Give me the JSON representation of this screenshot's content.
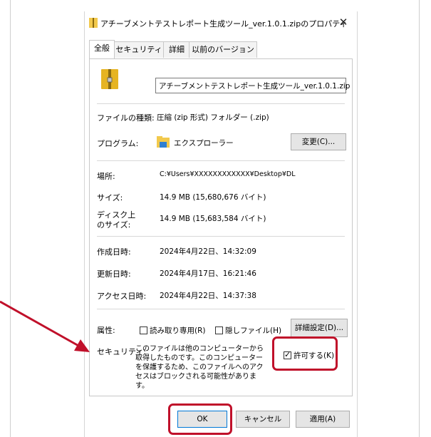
{
  "dialog": {
    "title": "アチーブメントテストレポート生成ツール_ver.1.0.1.zipのプロパティ",
    "close_symbol": "✕"
  },
  "tabs": [
    "全般",
    "セキュリティ",
    "詳細",
    "以前のバージョン"
  ],
  "general": {
    "file_name": "アチーブメントテストレポート生成ツール_ver.1.0.1.zip",
    "file_type_label": "ファイルの種類:",
    "file_type_value": "圧縮 (zip 形式) フォルダー (.zip)",
    "program_label": "プログラム:",
    "program_value": "エクスプローラー",
    "change_button": "変更(C)...",
    "location_label": "場所:",
    "location_value": "C:¥Users¥XXXXXXXXXXXX¥Desktop¥DL",
    "size_label": "サイズ:",
    "size_value": "14.9 MB (15,680,676 バイト)",
    "disk_size_label_1": "ディスク上",
    "disk_size_label_2": "のサイズ:",
    "disk_size_value": "14.9 MB (15,683,584 バイト)",
    "created_label": "作成日時:",
    "created_value": "2024年4月22日、14:32:09",
    "modified_label": "更新日時:",
    "modified_value": "2024年4月17日、16:21:46",
    "accessed_label": "アクセス日時:",
    "accessed_value": "2024年4月22日、14:37:38",
    "attributes_label": "属性:",
    "readonly_label": "読み取り専用(R)",
    "hidden_label": "隠しファイル(H)",
    "advanced_button": "詳細設定(D)...",
    "security_label": "セキュリティ:",
    "security_text": "このファイルは他のコンピューターから取得したものです。このコンピューターを保護するため、このファイルへのアクセスはブロックされる可能性があります。",
    "allow_label": "許可する(K)",
    "allow_checked": true
  },
  "footer": {
    "ok": "OK",
    "cancel": "キャンセル",
    "apply": "適用(A)"
  },
  "colors": {
    "highlight": "#c0102a",
    "folder": "#f2c94c",
    "zip": "#e6b422"
  },
  "icons": [
    "zip-folder-icon",
    "explorer-folder-icon",
    "close-icon",
    "checkbox-icon"
  ]
}
